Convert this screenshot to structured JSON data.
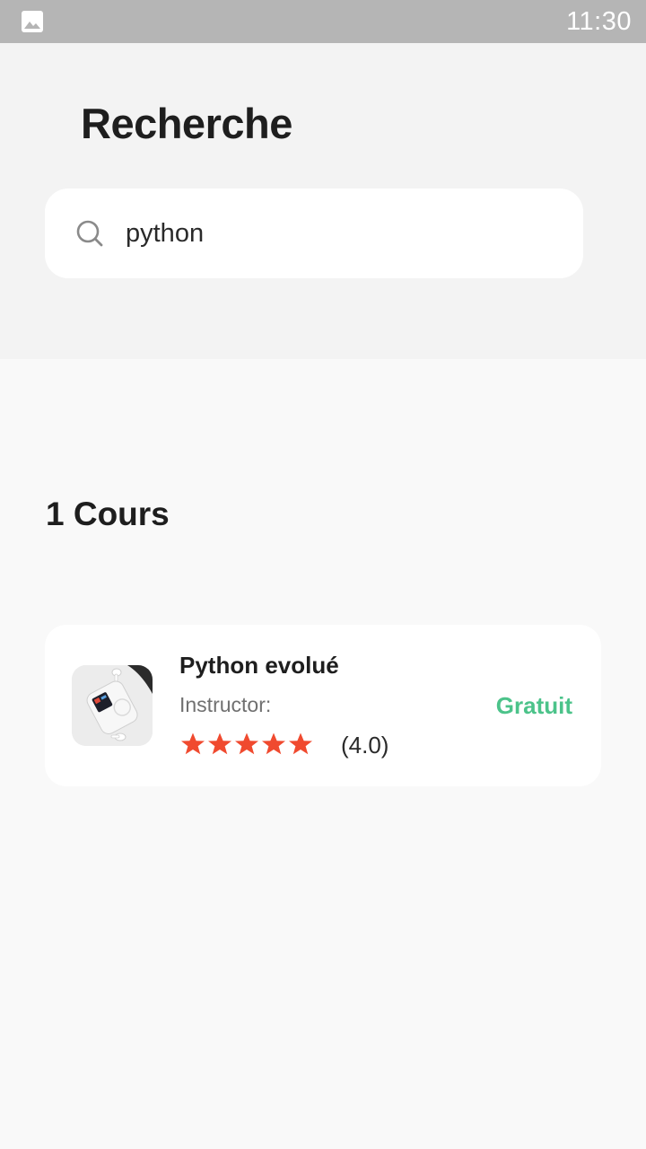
{
  "status_bar": {
    "time": "11:30",
    "notification_icon": "image-icon"
  },
  "header": {
    "title": "Recherche",
    "search": {
      "value": "python",
      "icon": "search-icon"
    }
  },
  "results": {
    "count_label": "1 Cours",
    "courses": [
      {
        "title": "Python evolué",
        "instructor_label": "Instructor:",
        "price": "Gratuit",
        "rating_display": "(4.0)",
        "rating": 4.0,
        "rating_max": 5,
        "star_color": "#f04a2f",
        "thumbnail": "music-player-device-image"
      }
    ]
  },
  "colors": {
    "status_bar": "#b5b5b5",
    "header_bg": "#f3f3f3",
    "page_bg": "#f9f9f9",
    "price": "#4cc38a",
    "star": "#f04a2f"
  }
}
